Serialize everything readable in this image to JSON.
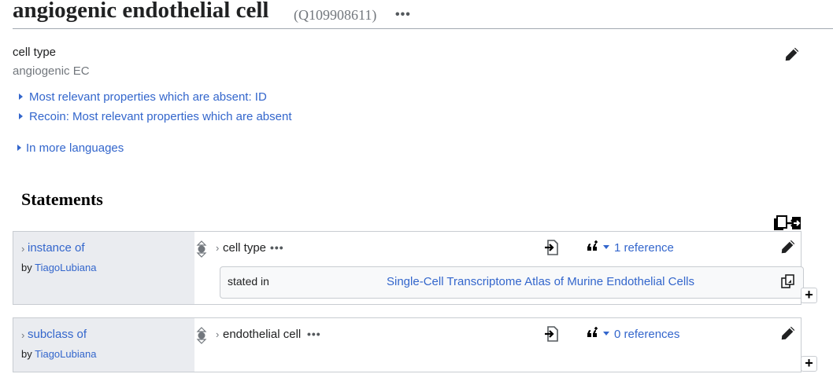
{
  "header": {
    "title": "angiogenic endothelial cell",
    "id": "(Q109908611)",
    "dots": "•••"
  },
  "description": {
    "label": "cell type",
    "alias": "angiogenic EC"
  },
  "toggles": {
    "absent_props": "Most relevant properties which are absent: ID",
    "recoin": "Recoin: Most relevant properties which are absent",
    "languages": "In more languages"
  },
  "statements": {
    "heading": "Statements",
    "items": [
      {
        "property": "instance of",
        "by_prefix": "by",
        "author": "TiagoLubiana",
        "value": "cell type",
        "dots": "•••",
        "references": "1 reference",
        "reference": {
          "label": "stated in",
          "value": "Single-Cell Transcriptome Atlas of Murine Endothelial Cells"
        }
      },
      {
        "property": "subclass of",
        "by_prefix": "by",
        "author": "TiagoLubiana",
        "value": "endothelial cell",
        "dots": "•••",
        "references": "0 references"
      }
    ]
  },
  "glyphs": {
    "chevron": "›",
    "plus": "+"
  },
  "icons": [
    "pencil-icon",
    "copy-statements-icon",
    "derived-reference-icon",
    "add-reference-icon",
    "rank-icon",
    "copy-icon"
  ]
}
